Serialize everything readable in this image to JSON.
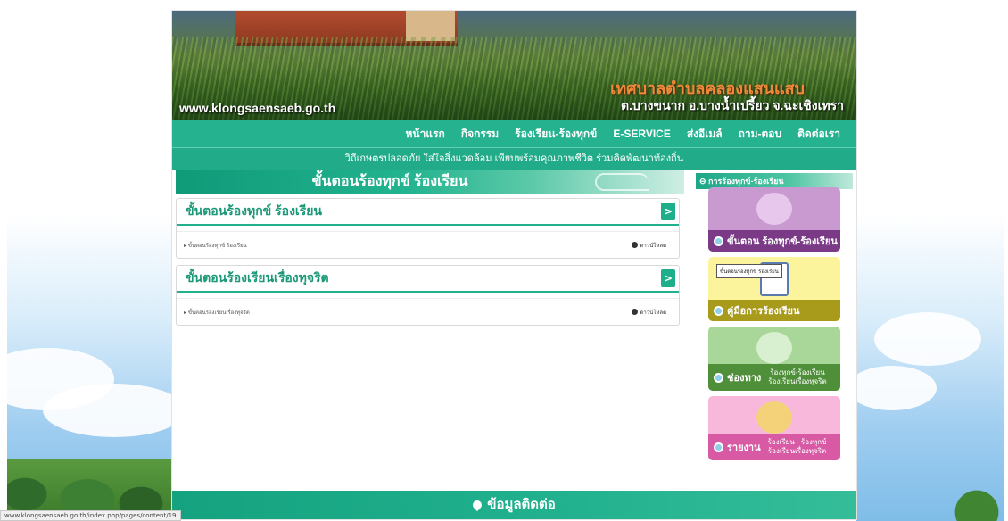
{
  "header": {
    "site_url": "www.klongsaensaeb.go.th",
    "title": "เทศบาลตำบลคลองแสนแสบ",
    "address": "ต.บางขนาก อ.บางน้ำเปรี้ยว จ.ฉะเชิงเทรา"
  },
  "nav": {
    "items": [
      "หน้าแรก",
      "กิจกรรม",
      "ร้องเรียน-ร้องทุกข์",
      "E-SERVICE",
      "ส่งอีเมล์",
      "ถาม-ตอบ",
      "ติดต่อเรา"
    ]
  },
  "slogan": "วิถีเกษตรปลอดภัย ใส่ใจสิ่งแวดล้อม เพียบพร้อมคุณภาพชีวิต ร่วมคิดพัฒนาท้องถิ่น",
  "content": {
    "page_title": "ขั้นตอนร้องทุกข์ ร้องเรียน",
    "cards": [
      {
        "title": "ขั้นตอนร้องทุกข์ ร้องเรียน",
        "arrow": ">",
        "row": {
          "label": "ขั้นตอนร้องทุกข์ ร้องเรียน",
          "download": "ดาวน์โหลด"
        }
      },
      {
        "title": "ขั้นตอนร้องเรียนเรื่องทุจริต",
        "arrow": ">",
        "row": {
          "label": "ขั้นตอนร้องเรียนเรื่องทุจริต",
          "download": "ดาวน์โหลด"
        }
      }
    ]
  },
  "sidebar": {
    "heading": "การร้องทุกข์-ร้องเรียน",
    "tooltip": "ขั้นตอนร้องทุกข์ ร้องเรียน",
    "items": [
      {
        "label": "ขั้นตอน ร้องทุกข์-ร้องเรียน",
        "bg": "#c89ad0",
        "bar": "#7a3a86"
      },
      {
        "label": "คู่มือการร้องเรียน",
        "bg": "#fbf49c",
        "bar": "#a89a1a"
      },
      {
        "label": "ช่องทาง",
        "sub1": "ร้องทุกข์-ร้องเรียน",
        "sub2": "ร้องเรียนเรื่องทุจริต",
        "bg": "#a9d79a",
        "bar": "#4f8f3a"
      },
      {
        "label": "รายงาน",
        "sub1": "ร้องเรียน - ร้องทุกข์",
        "sub2": "ร้องเรียนเรื่องทุจริต",
        "bg": "#f7b8dc",
        "bar": "#d85aa5"
      }
    ]
  },
  "footer": {
    "label": "ข้อมูลติดต่อ"
  },
  "status_bar": {
    "url": "www.klongsaensaeb.go.th/index.php/pages/content/19"
  }
}
